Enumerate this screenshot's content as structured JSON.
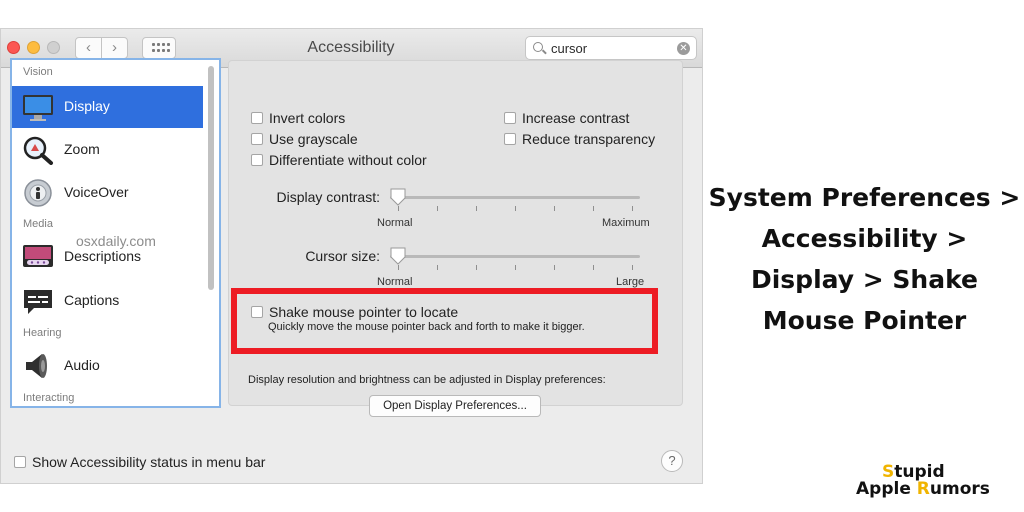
{
  "window": {
    "title": "Accessibility",
    "back": "‹",
    "forward": "›",
    "search": {
      "value": "cursor",
      "clear": "✕"
    }
  },
  "sidebar": {
    "headers": [
      "Vision",
      "Media",
      "Hearing",
      "Interacting"
    ],
    "items": [
      {
        "label": "Display",
        "icon": "display-icon",
        "selected": true
      },
      {
        "label": "Zoom",
        "icon": "zoom-icon"
      },
      {
        "label": "VoiceOver",
        "icon": "voiceover-icon"
      },
      {
        "label": "Descriptions",
        "icon": "descriptions-icon"
      },
      {
        "label": "Captions",
        "icon": "captions-icon"
      },
      {
        "label": "Audio",
        "icon": "audio-icon"
      }
    ],
    "watermark": "osxdaily.com"
  },
  "display": {
    "options": [
      "Invert colors",
      "Use grayscale",
      "Differentiate without color",
      "Increase contrast",
      "Reduce transparency"
    ],
    "contrast": {
      "label": "Display contrast:",
      "min_label": "Normal",
      "max_label": "Maximum",
      "value": 0
    },
    "cursor": {
      "label": "Cursor size:",
      "min_label": "Normal",
      "max_label": "Large",
      "value": 0
    },
    "shake": {
      "label": "Shake mouse pointer to locate",
      "desc": "Quickly move the mouse pointer back and forth to make it bigger."
    },
    "info": "Display resolution and brightness can be adjusted in Display preferences:",
    "button": "Open Display Preferences..."
  },
  "footer": {
    "status": "Show Accessibility status in menu bar",
    "help": "?"
  },
  "caption": {
    "lines": [
      "System Preferences >",
      "Accessibility >",
      "Display > Shake",
      "Mouse Pointer"
    ]
  },
  "logo": {
    "s": "S",
    "tupid": "tupid",
    "apple": "Apple ",
    "r": "R",
    "umors": "umors"
  },
  "colors": {
    "selection": "#2f6fde",
    "highlight": "#ed1c24",
    "logo_accent": "#f0b400"
  }
}
